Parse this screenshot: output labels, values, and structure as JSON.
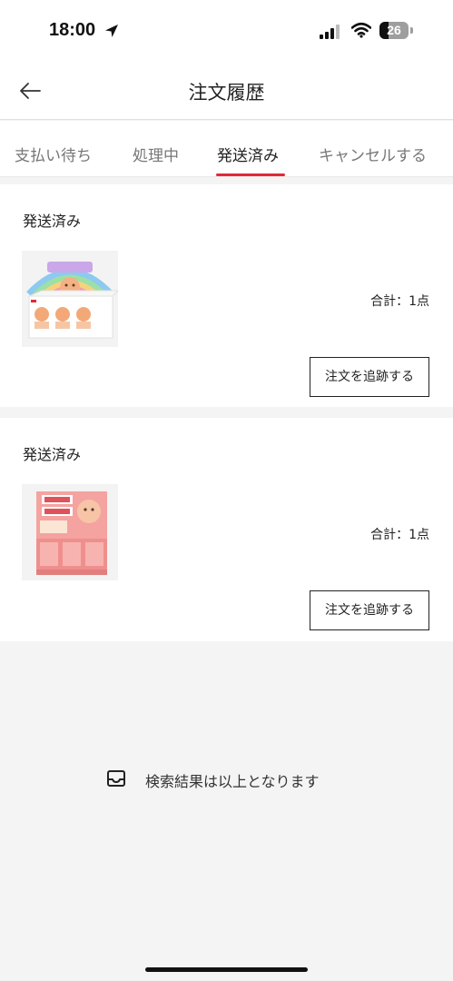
{
  "status_bar": {
    "time": "18:00",
    "battery": "26"
  },
  "header": {
    "title": "注文履歴"
  },
  "tabs": [
    {
      "label": "支払い待ち",
      "active": false
    },
    {
      "label": "処理中",
      "active": false
    },
    {
      "label": "発送済み",
      "active": true
    },
    {
      "label": "キャンセルする",
      "active": false
    }
  ],
  "orders": [
    {
      "status": "発送済み",
      "summary": "合計：1点",
      "track_label": "注文を追跡する",
      "thumbnail": "rainbow-figure-box-icon"
    },
    {
      "status": "発送済み",
      "summary": "合計：1点",
      "track_label": "注文を追跡する",
      "thumbnail": "nagi-pupu-box-icon"
    }
  ],
  "footer": {
    "end_message": "検索結果は以上となります"
  },
  "colors": {
    "accent": "#e02a36",
    "background": "#f4f4f4"
  }
}
